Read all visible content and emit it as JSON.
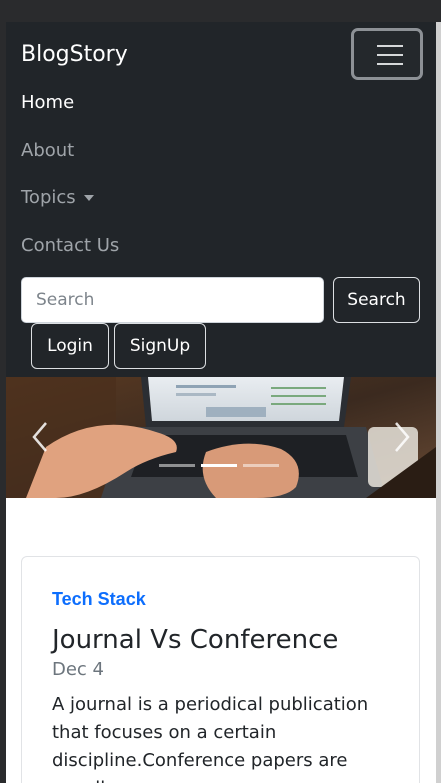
{
  "navbar": {
    "brand": "BlogStory",
    "links": [
      {
        "label": "Home",
        "active": true
      },
      {
        "label": "About",
        "active": false
      },
      {
        "label": "Topics",
        "active": false,
        "dropdown": true
      },
      {
        "label": "Contact Us",
        "active": false
      }
    ],
    "toggler_icon": "hamburger-icon"
  },
  "search": {
    "placeholder": "Search",
    "value": "",
    "button_label": "Search"
  },
  "auth": {
    "login_label": "Login",
    "signup_label": "SignUp"
  },
  "carousel": {
    "image_subject": "laptop-typing-photo",
    "slide_count": 3,
    "active_slide": 2,
    "prev_icon": "chevron-left-icon",
    "next_icon": "chevron-right-icon"
  },
  "post": {
    "category": "Tech Stack",
    "title": "Journal Vs Conference",
    "date": "Dec 4",
    "excerpt": "A journal is a periodical publication that focuses on a certain discipline.Conference papers are usually"
  },
  "colors": {
    "navbar_bg": "#212529",
    "accent": "#0d6efd",
    "nav_muted": "#9fa4a9"
  }
}
